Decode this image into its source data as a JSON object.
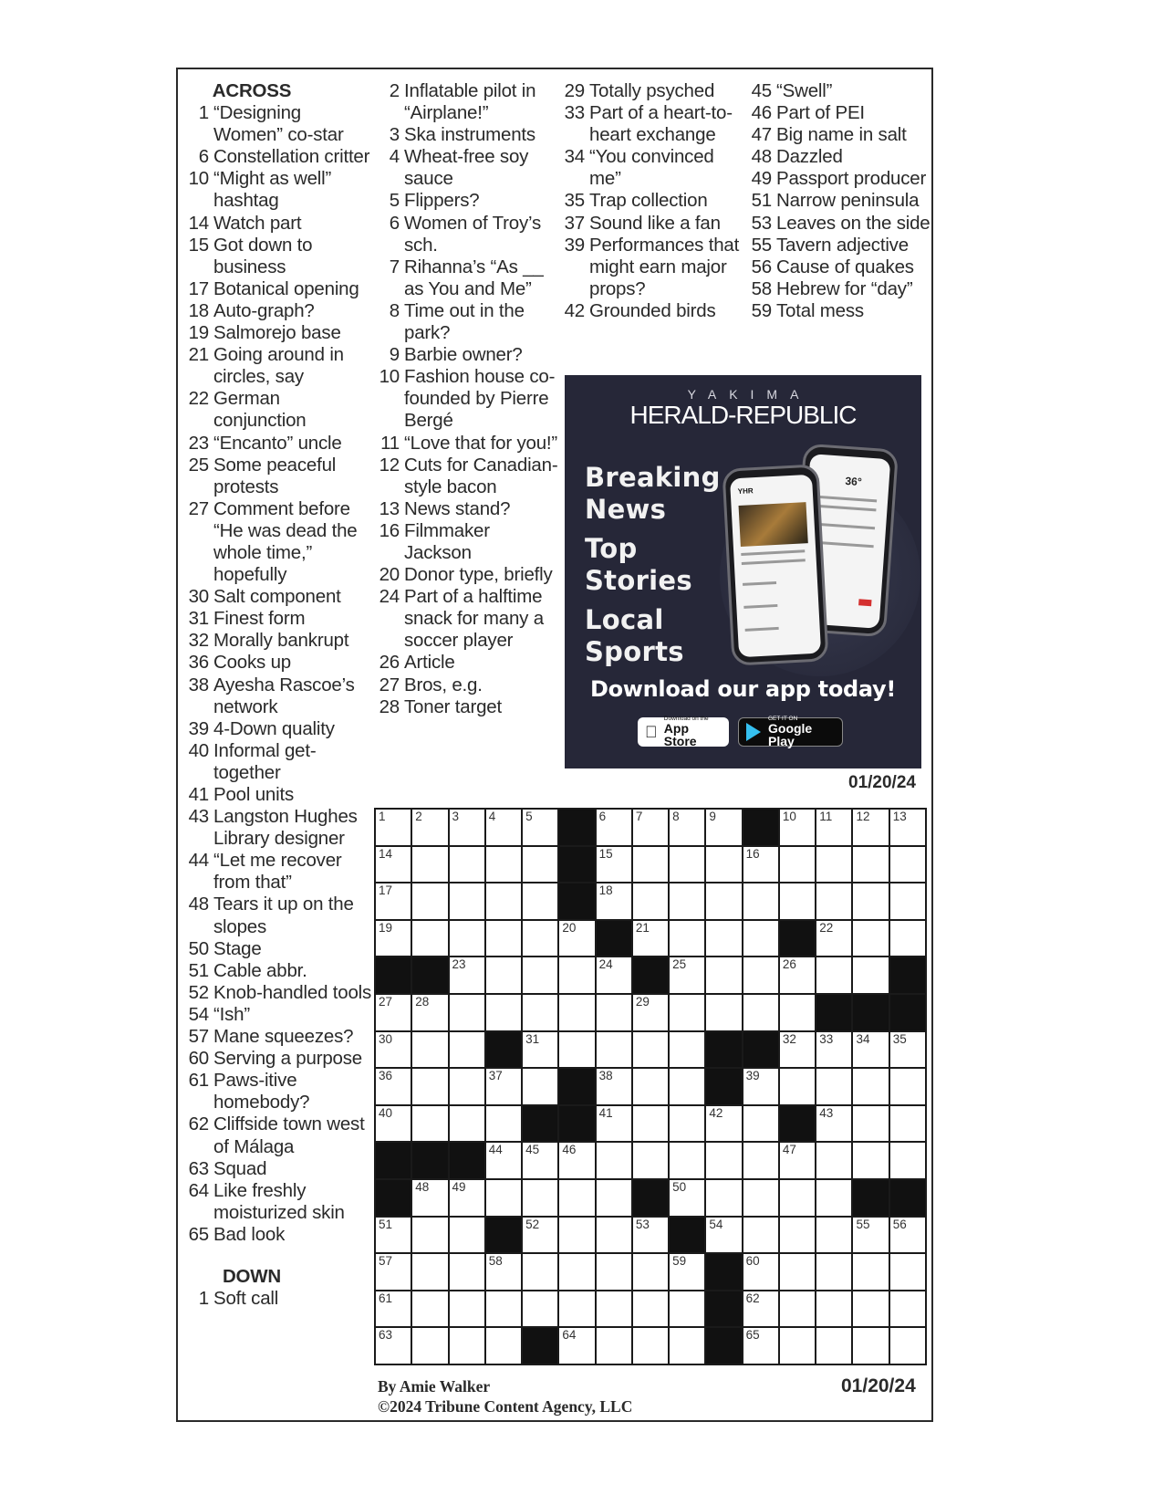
{
  "across": {
    "heading": "ACROSS",
    "clues": [
      {
        "num": "1",
        "text": "“Designing Women” co-star"
      },
      {
        "num": "6",
        "text": "Constellation critter"
      },
      {
        "num": "10",
        "text": "“Might as well” hashtag"
      },
      {
        "num": "14",
        "text": "Watch part"
      },
      {
        "num": "15",
        "text": "Got down to business"
      },
      {
        "num": "17",
        "text": "Botanical opening"
      },
      {
        "num": "18",
        "text": "Auto-graph?"
      },
      {
        "num": "19",
        "text": "Salmorejo base"
      },
      {
        "num": "21",
        "text": "Going around in circles, say"
      },
      {
        "num": "22",
        "text": "German conjunction"
      },
      {
        "num": "23",
        "text": "“Encanto” uncle"
      },
      {
        "num": "25",
        "text": "Some peaceful protests"
      },
      {
        "num": "27",
        "text": "Comment before “He was dead the whole time,” hopefully"
      },
      {
        "num": "30",
        "text": "Salt component"
      },
      {
        "num": "31",
        "text": "Finest form"
      },
      {
        "num": "32",
        "text": "Morally bankrupt"
      },
      {
        "num": "36",
        "text": "Cooks up"
      },
      {
        "num": "38",
        "text": "Ayesha Rascoe’s network"
      },
      {
        "num": "39",
        "text": "4-Down quality"
      },
      {
        "num": "40",
        "text": "Informal get-together"
      },
      {
        "num": "41",
        "text": "Pool units"
      },
      {
        "num": "43",
        "text": "Langston Hughes Library designer"
      },
      {
        "num": "44",
        "text": "“Let me recover from that”"
      },
      {
        "num": "48",
        "text": "Tears it up on the slopes"
      },
      {
        "num": "50",
        "text": "Stage"
      },
      {
        "num": "51",
        "text": "Cable abbr."
      },
      {
        "num": "52",
        "text": "Knob-handled tools"
      },
      {
        "num": "54",
        "text": "“Ish”"
      },
      {
        "num": "57",
        "text": "Mane squeezes?"
      },
      {
        "num": "60",
        "text": "Serving a purpose"
      },
      {
        "num": "61",
        "text": "Paws-itive homebody?"
      },
      {
        "num": "62",
        "text": "Cliffside town west of Málaga"
      },
      {
        "num": "63",
        "text": "Squad"
      },
      {
        "num": "64",
        "text": "Like freshly moisturized skin"
      },
      {
        "num": "65",
        "text": "Bad look"
      }
    ]
  },
  "down": {
    "heading": "DOWN",
    "clues": [
      {
        "num": "1",
        "text": "Soft call"
      },
      {
        "num": "2",
        "text": "Inflatable pilot in “Airplane!”"
      },
      {
        "num": "3",
        "text": "Ska instruments"
      },
      {
        "num": "4",
        "text": "Wheat-free soy sauce"
      },
      {
        "num": "5",
        "text": "Flippers?"
      },
      {
        "num": "6",
        "text": "Women of Troy’s sch."
      },
      {
        "num": "7",
        "text": "Rihanna’s “As __ as You and Me”"
      },
      {
        "num": "8",
        "text": "Time out in the park?"
      },
      {
        "num": "9",
        "text": "Barbie owner?"
      },
      {
        "num": "10",
        "text": "Fashion house co-founded by Pierre Bergé"
      },
      {
        "num": "11",
        "text": "“Love that for you!”"
      },
      {
        "num": "12",
        "text": "Cuts for Canadian-style bacon"
      },
      {
        "num": "13",
        "text": "News stand?"
      },
      {
        "num": "16",
        "text": "Filmmaker Jackson"
      },
      {
        "num": "20",
        "text": "Donor type, briefly"
      },
      {
        "num": "24",
        "text": "Part of a halftime snack for many a soccer player"
      },
      {
        "num": "26",
        "text": "Article"
      },
      {
        "num": "27",
        "text": "Bros, e.g."
      },
      {
        "num": "28",
        "text": "Toner target"
      },
      {
        "num": "29",
        "text": "Totally psyched"
      },
      {
        "num": "33",
        "text": "Part of a heart-to-heart exchange"
      },
      {
        "num": "34",
        "text": "“You convinced me”"
      },
      {
        "num": "35",
        "text": "Trap collection"
      },
      {
        "num": "37",
        "text": "Sound like a fan"
      },
      {
        "num": "39",
        "text": "Performances that might earn major props?"
      },
      {
        "num": "42",
        "text": "Grounded birds"
      },
      {
        "num": "45",
        "text": "“Swell”"
      },
      {
        "num": "46",
        "text": "Part of PEI"
      },
      {
        "num": "47",
        "text": "Big name in salt"
      },
      {
        "num": "48",
        "text": "Dazzled"
      },
      {
        "num": "49",
        "text": "Passport producer"
      },
      {
        "num": "51",
        "text": "Narrow peninsula"
      },
      {
        "num": "53",
        "text": "Leaves on the side"
      },
      {
        "num": "55",
        "text": "Tavern adjective"
      },
      {
        "num": "56",
        "text": "Cause of quakes"
      },
      {
        "num": "58",
        "text": "Hebrew for “day”"
      },
      {
        "num": "59",
        "text": "Total mess"
      }
    ]
  },
  "grid": {
    "rows": [
      ".....#....#....",
      ".....#.........",
      ".....#.........",
      "......#....#...",
      "##.....#......#",
      "............###",
      "...#.....##....",
      ".....#...#.....",
      "....##.....#...",
      "###............",
      "#......#.....##",
      "...#....#......",
      ".........#.....",
      ".........#.....",
      "....#....#....."
    ]
  },
  "ad": {
    "brand_small": "YAKIMA",
    "brand": "HERALD-REPUBLIC",
    "features": [
      "Breaking News",
      "Top Stories",
      "Local Sports"
    ],
    "feature_lines": [
      [
        "Breaking",
        "News"
      ],
      [
        "Top",
        "Stories"
      ],
      [
        "Local",
        "Sports"
      ]
    ],
    "cta": "Download our app today!",
    "app_store_small": "Download on the",
    "app_store": "App Store",
    "google_small": "GET IT ON",
    "google": "Google Play",
    "phone_temp": "36°",
    "phone_app_label": "YHR"
  },
  "date_top": "01/20/24",
  "date_bottom": "01/20/24",
  "byline": "By Amie Walker",
  "copyright": "©2024 Tribune Content Agency, LLC"
}
